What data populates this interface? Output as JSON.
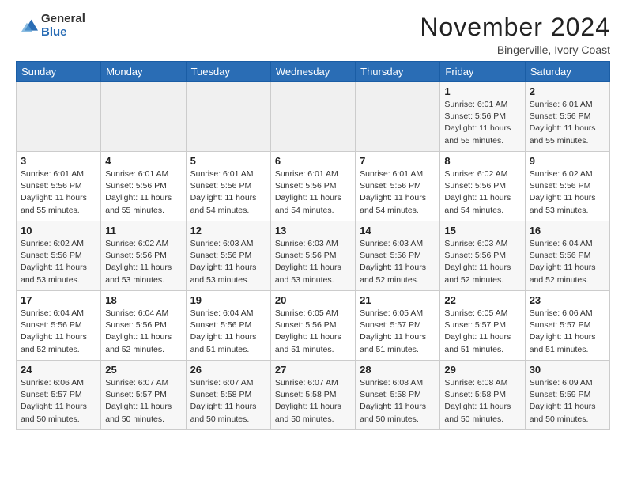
{
  "header": {
    "logo_line1": "General",
    "logo_line2": "Blue",
    "month": "November 2024",
    "location": "Bingerville, Ivory Coast"
  },
  "weekdays": [
    "Sunday",
    "Monday",
    "Tuesday",
    "Wednesday",
    "Thursday",
    "Friday",
    "Saturday"
  ],
  "weeks": [
    [
      {
        "day": "",
        "info": ""
      },
      {
        "day": "",
        "info": ""
      },
      {
        "day": "",
        "info": ""
      },
      {
        "day": "",
        "info": ""
      },
      {
        "day": "",
        "info": ""
      },
      {
        "day": "1",
        "info": "Sunrise: 6:01 AM\nSunset: 5:56 PM\nDaylight: 11 hours and 55 minutes."
      },
      {
        "day": "2",
        "info": "Sunrise: 6:01 AM\nSunset: 5:56 PM\nDaylight: 11 hours and 55 minutes."
      }
    ],
    [
      {
        "day": "3",
        "info": "Sunrise: 6:01 AM\nSunset: 5:56 PM\nDaylight: 11 hours and 55 minutes."
      },
      {
        "day": "4",
        "info": "Sunrise: 6:01 AM\nSunset: 5:56 PM\nDaylight: 11 hours and 55 minutes."
      },
      {
        "day": "5",
        "info": "Sunrise: 6:01 AM\nSunset: 5:56 PM\nDaylight: 11 hours and 54 minutes."
      },
      {
        "day": "6",
        "info": "Sunrise: 6:01 AM\nSunset: 5:56 PM\nDaylight: 11 hours and 54 minutes."
      },
      {
        "day": "7",
        "info": "Sunrise: 6:01 AM\nSunset: 5:56 PM\nDaylight: 11 hours and 54 minutes."
      },
      {
        "day": "8",
        "info": "Sunrise: 6:02 AM\nSunset: 5:56 PM\nDaylight: 11 hours and 54 minutes."
      },
      {
        "day": "9",
        "info": "Sunrise: 6:02 AM\nSunset: 5:56 PM\nDaylight: 11 hours and 53 minutes."
      }
    ],
    [
      {
        "day": "10",
        "info": "Sunrise: 6:02 AM\nSunset: 5:56 PM\nDaylight: 11 hours and 53 minutes."
      },
      {
        "day": "11",
        "info": "Sunrise: 6:02 AM\nSunset: 5:56 PM\nDaylight: 11 hours and 53 minutes."
      },
      {
        "day": "12",
        "info": "Sunrise: 6:03 AM\nSunset: 5:56 PM\nDaylight: 11 hours and 53 minutes."
      },
      {
        "day": "13",
        "info": "Sunrise: 6:03 AM\nSunset: 5:56 PM\nDaylight: 11 hours and 53 minutes."
      },
      {
        "day": "14",
        "info": "Sunrise: 6:03 AM\nSunset: 5:56 PM\nDaylight: 11 hours and 52 minutes."
      },
      {
        "day": "15",
        "info": "Sunrise: 6:03 AM\nSunset: 5:56 PM\nDaylight: 11 hours and 52 minutes."
      },
      {
        "day": "16",
        "info": "Sunrise: 6:04 AM\nSunset: 5:56 PM\nDaylight: 11 hours and 52 minutes."
      }
    ],
    [
      {
        "day": "17",
        "info": "Sunrise: 6:04 AM\nSunset: 5:56 PM\nDaylight: 11 hours and 52 minutes."
      },
      {
        "day": "18",
        "info": "Sunrise: 6:04 AM\nSunset: 5:56 PM\nDaylight: 11 hours and 52 minutes."
      },
      {
        "day": "19",
        "info": "Sunrise: 6:04 AM\nSunset: 5:56 PM\nDaylight: 11 hours and 51 minutes."
      },
      {
        "day": "20",
        "info": "Sunrise: 6:05 AM\nSunset: 5:56 PM\nDaylight: 11 hours and 51 minutes."
      },
      {
        "day": "21",
        "info": "Sunrise: 6:05 AM\nSunset: 5:57 PM\nDaylight: 11 hours and 51 minutes."
      },
      {
        "day": "22",
        "info": "Sunrise: 6:05 AM\nSunset: 5:57 PM\nDaylight: 11 hours and 51 minutes."
      },
      {
        "day": "23",
        "info": "Sunrise: 6:06 AM\nSunset: 5:57 PM\nDaylight: 11 hours and 51 minutes."
      }
    ],
    [
      {
        "day": "24",
        "info": "Sunrise: 6:06 AM\nSunset: 5:57 PM\nDaylight: 11 hours and 50 minutes."
      },
      {
        "day": "25",
        "info": "Sunrise: 6:07 AM\nSunset: 5:57 PM\nDaylight: 11 hours and 50 minutes."
      },
      {
        "day": "26",
        "info": "Sunrise: 6:07 AM\nSunset: 5:58 PM\nDaylight: 11 hours and 50 minutes."
      },
      {
        "day": "27",
        "info": "Sunrise: 6:07 AM\nSunset: 5:58 PM\nDaylight: 11 hours and 50 minutes."
      },
      {
        "day": "28",
        "info": "Sunrise: 6:08 AM\nSunset: 5:58 PM\nDaylight: 11 hours and 50 minutes."
      },
      {
        "day": "29",
        "info": "Sunrise: 6:08 AM\nSunset: 5:58 PM\nDaylight: 11 hours and 50 minutes."
      },
      {
        "day": "30",
        "info": "Sunrise: 6:09 AM\nSunset: 5:59 PM\nDaylight: 11 hours and 50 minutes."
      }
    ]
  ]
}
